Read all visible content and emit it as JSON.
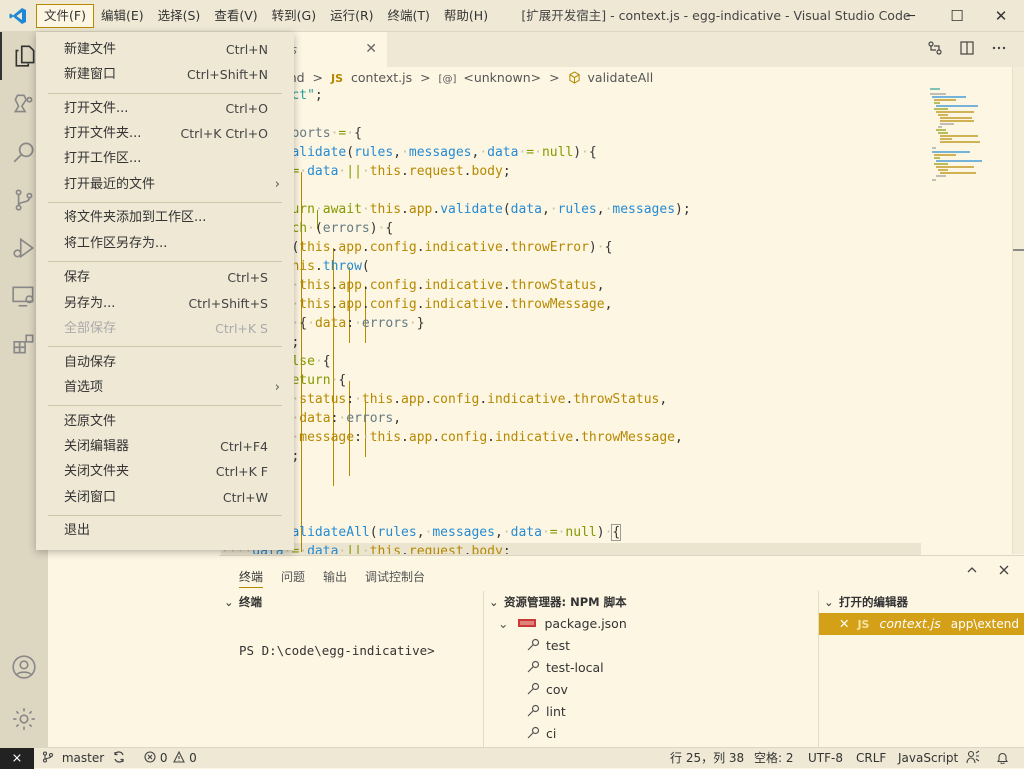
{
  "window": {
    "title": "[扩展开发宿主] - context.js - egg-indicative - Visual Studio Code",
    "minimize": "─",
    "maximize": "☐",
    "close": "✕"
  },
  "menubar": [
    "文件(F)",
    "编辑(E)",
    "选择(S)",
    "查看(V)",
    "转到(G)",
    "运行(R)",
    "终端(T)",
    "帮助(H)"
  ],
  "file_menu": {
    "items": [
      {
        "label": "新建文件",
        "shortcut": "Ctrl+N"
      },
      {
        "label": "新建窗口",
        "shortcut": "Ctrl+Shift+N"
      },
      {
        "label": "打开文件...",
        "shortcut": "Ctrl+O"
      },
      {
        "label": "打开文件夹...",
        "shortcut": "Ctrl+K Ctrl+O"
      },
      {
        "label": "打开工作区...",
        "shortcut": ""
      },
      {
        "label": "打开最近的文件",
        "shortcut": ""
      },
      {
        "label": "将文件夹添加到工作区...",
        "shortcut": ""
      },
      {
        "label": "将工作区另存为...",
        "shortcut": ""
      },
      {
        "label": "保存",
        "shortcut": "Ctrl+S"
      },
      {
        "label": "另存为...",
        "shortcut": "Ctrl+Shift+S"
      },
      {
        "label": "全部保存",
        "shortcut": "Ctrl+K S"
      },
      {
        "label": "自动保存",
        "shortcut": ""
      },
      {
        "label": "首选项",
        "shortcut": ""
      },
      {
        "label": "还原文件",
        "shortcut": ""
      },
      {
        "label": "关闭编辑器",
        "shortcut": "Ctrl+F4"
      },
      {
        "label": "关闭文件夹",
        "shortcut": "Ctrl+K F"
      },
      {
        "label": "关闭窗口",
        "shortcut": "Ctrl+W"
      },
      {
        "label": "退出",
        "shortcut": ""
      }
    ],
    "submenu_arrow": "›"
  },
  "editor": {
    "tab_name": "is",
    "tab_close": "✕",
    "breadcrumb": {
      "seg1": "end",
      "sep": ">",
      "js_badge": "JS",
      "file": "context.js",
      "unknown_icon": "[@]",
      "unknown": "<unknown>",
      "method": "validateAll"
    }
  },
  "panel": {
    "tabs": [
      "终端",
      "问题",
      "输出",
      "调试控制台"
    ],
    "terminal": {
      "title": "终端",
      "prompt": "PS D:\\code\\egg-indicative>"
    },
    "npm": {
      "title": "资源管理器: NPM 脚本",
      "package": "package.json",
      "scripts": [
        "test",
        "test-local",
        "cov",
        "lint",
        "ci"
      ]
    },
    "open_editors": {
      "title": "打开的编辑器",
      "close": "✕",
      "badge": "JS",
      "file": "context.js",
      "path": "app\\extend"
    }
  },
  "statusbar": {
    "remote": "⨯",
    "branch": "master",
    "errors": "0",
    "warnings": "0",
    "position": "行 25，列 38",
    "spaces": "空格: 2",
    "encoding": "UTF-8",
    "eol": "CRLF",
    "language": "JavaScript"
  },
  "colors": {
    "accent": "#b58900",
    "selection": "#d4a017",
    "background": "#fdf6e3"
  }
}
